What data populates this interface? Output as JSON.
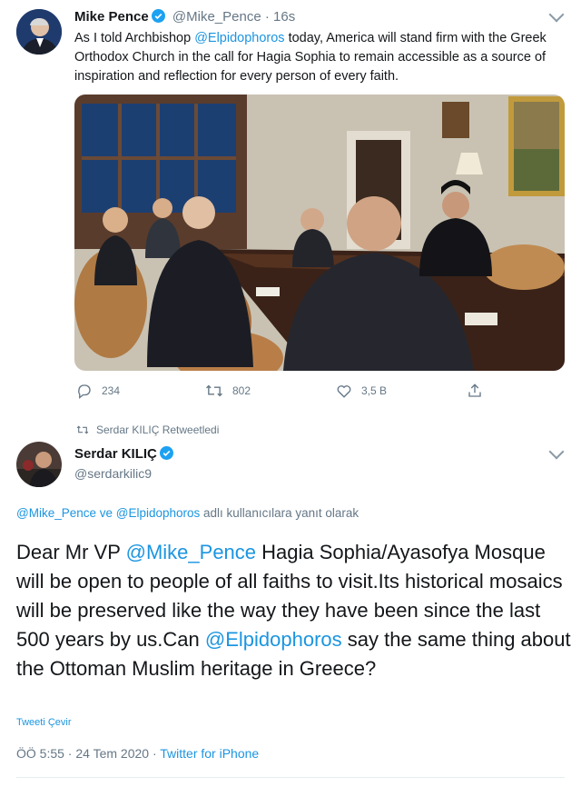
{
  "tweet1": {
    "author_name": "Mike Pence",
    "handle": "@Mike_Pence",
    "separator": "·",
    "time": "16s",
    "text_before_mention1": "As I told Archbishop ",
    "mention1": "@Elpidophoros",
    "text_after_mention1": " today, America will stand firm with the Greek Orthodox Church in the call for Hagia Sophia to remain accessible as a source of inspiration and reflection for every person of every faith.",
    "replies": "234",
    "retweets": "802",
    "likes": "3,5 B"
  },
  "retweet_context": {
    "text": "Serdar KILIÇ Retweetledi"
  },
  "tweet2": {
    "author_name": "Serdar KILIÇ",
    "handle": "@serdarkilic9",
    "reply_to_m1": "@Mike_Pence",
    "reply_to_ve": " ve ",
    "reply_to_m2": "@Elpidophoros",
    "reply_to_rest": " adlı kullanıcılara yanıt olarak",
    "body_1": "Dear Mr VP ",
    "body_mention1": "@Mike_Pence",
    "body_2": " Hagia Sophia/Ayasofya Mosque will be open to people of all faiths to visit.Its historical mosaics will be preserved like the way they have been since the last 500 years by us.Can ",
    "body_mention2": "@Elpidophoros",
    "body_3": " say the same thing about the Ottoman Muslim heritage in Greece?",
    "translate": "Tweeti Çevir",
    "timestamp": "ÖÖ 5:55 · 24 Tem 2020 · ",
    "source": "Twitter for iPhone"
  },
  "colors": {
    "accent": "#1b95e0",
    "muted": "#657786",
    "verified": "#1da1f2"
  },
  "icons": [
    "reply-icon",
    "retweet-icon",
    "like-icon",
    "share-icon",
    "verified-icon",
    "chevron-down-icon"
  ]
}
